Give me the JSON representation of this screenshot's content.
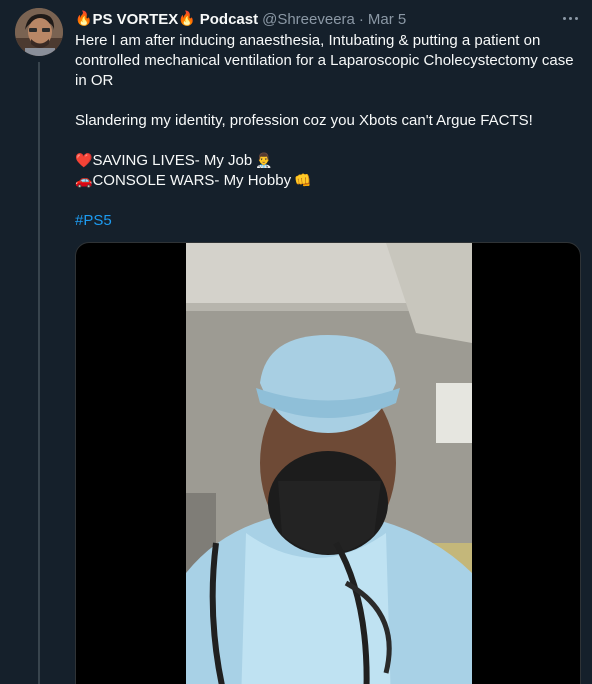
{
  "tweet": {
    "display_name_prefix_emoji": "🔥",
    "display_name": "PS VORTEX",
    "display_name_suffix_emoji": "🔥",
    "display_name_suffix": "Podcast",
    "handle": "@Shreeveera",
    "separator": "·",
    "date": "Mar 5",
    "text_line1": "Here I am after inducing anaesthesia, Intubating & putting a patient on controlled mechanical ventilation for a Laparoscopic Cholecystectomy case in OR",
    "text_line2": "Slandering my identity, profession coz you Xbots can't Argue FACTS!",
    "line3_emoji": "❤️",
    "line3_text": "SAVING LIVES- My Job",
    "line3_trailing_emoji": "👨‍⚕️",
    "line4_emoji": "🚗",
    "line4_text": "CONSOLE WARS- My Hobby",
    "line4_trailing_emoji": "👊",
    "hashtag": "#PS5"
  },
  "colors": {
    "background": "#15202b",
    "text": "#f7f9f9",
    "muted": "#8b98a5",
    "link": "#1d9bf0",
    "heart": "#e0245e"
  },
  "icons": {
    "more": "more-horizontal-icon"
  }
}
